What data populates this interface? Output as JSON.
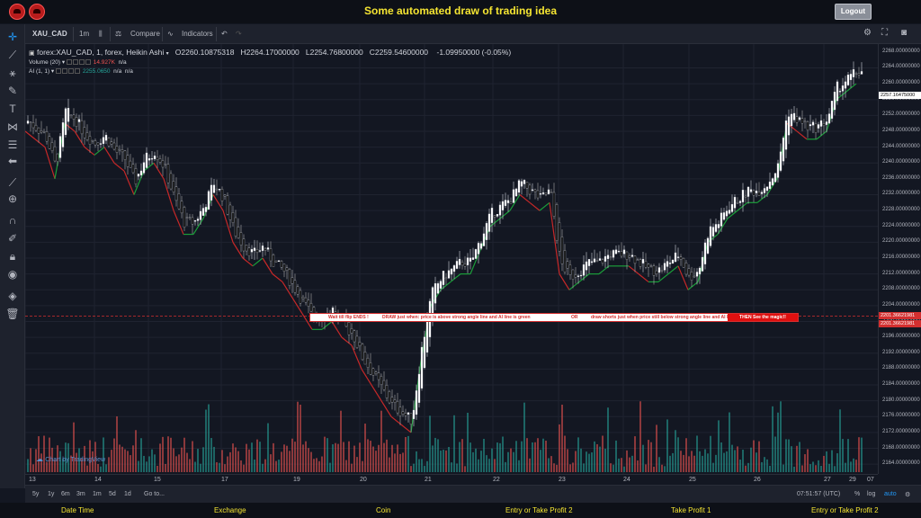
{
  "header": {
    "title": "Some automated draw of trading idea",
    "logout_label": "Logout"
  },
  "toolbar": {
    "symbol": "XAU_CAD",
    "interval": "1m",
    "compare_label": "Compare",
    "indicators_label": "Indicators"
  },
  "legend": {
    "title": "forex:XAU_CAD, 1, forex, Heikin Ashi",
    "open": "O2260.10875318",
    "high": "H2264.17000000",
    "low": "L2254.76800000",
    "close": "C2259.54600000",
    "change": "-1.09950000 (-0.05%)",
    "volume_label": "Volume (20)",
    "volume_value": "14.927K",
    "volume_na": "n/a",
    "ai_label": "AI (1, 1)",
    "ai_value": "2255.0650",
    "ai_na1": "n/a",
    "ai_na2": "n/a"
  },
  "banner": {
    "part1": "Wait till flip ENDS !",
    "part2": "DRAW just when:  price is above strong angle line and AI line is green",
    "part3": "OR",
    "part4": "draw shorts just when price still below strong angle line and AI line is red",
    "magic": "THEN See the magic!!"
  },
  "price_axis": {
    "ticks": [
      "2268.00000000",
      "2264.00000000",
      "2260.00000000",
      "2256.00000000",
      "2252.00000000",
      "2248.00000000",
      "2244.00000000",
      "2240.00000000",
      "2236.00000000",
      "2232.00000000",
      "2228.00000000",
      "2224.00000000",
      "2220.00000000",
      "2216.00000000",
      "2212.00000000",
      "2208.00000000",
      "2204.00000000",
      "2200.00000000",
      "2196.00000000",
      "2192.00000000",
      "2188.00000000",
      "2184.00000000",
      "2180.00000000",
      "2176.00000000",
      "2172.00000000",
      "2168.00000000",
      "2164.00000000"
    ],
    "current_price": "2257.16475000",
    "line_price_1": "2201.36621981",
    "line_price_2": "2201.36621981"
  },
  "time_axis": {
    "ticks": [
      "13",
      "14",
      "15",
      "16",
      "17",
      "18",
      "19",
      "20",
      "21",
      "22",
      "23",
      "24",
      "25",
      "26",
      "27",
      "28",
      "29",
      "29",
      "07"
    ]
  },
  "range_bar": {
    "ranges": [
      "5y",
      "1y",
      "6m",
      "3m",
      "1m",
      "5d",
      "1d"
    ],
    "goto": "Go to...",
    "clock": "07:51:57 (UTC)",
    "pct": "%",
    "log": "log",
    "auto": "auto"
  },
  "watermark": "Chart by TradingView",
  "bottom_nav": {
    "items": [
      "Date Time",
      "Exchange",
      "Coin",
      "Entry or Take Profit 2",
      "Take Profit 1",
      "Entry or Take Profit 2"
    ]
  },
  "colors": {
    "background": "#131722",
    "up": "#26a69a",
    "down": "#ef5350",
    "ai_line_green": "#1b9e3a",
    "ai_line_red": "#c62828",
    "title_yellow": "#f5e532"
  },
  "chart_data": {
    "type": "line",
    "ylim": [
      2162,
      2270
    ],
    "ai_line": [
      [
        0,
        2248
      ],
      [
        10,
        2246
      ],
      [
        20,
        2244
      ],
      [
        30,
        2236
      ],
      [
        40,
        2250
      ],
      [
        50,
        2248
      ],
      [
        60,
        2244
      ],
      [
        70,
        2242
      ],
      [
        80,
        2244
      ],
      [
        90,
        2240
      ],
      [
        100,
        2238
      ],
      [
        110,
        2232
      ],
      [
        120,
        2238
      ],
      [
        130,
        2240
      ],
      [
        140,
        2236
      ],
      [
        150,
        2228
      ],
      [
        160,
        2222
      ],
      [
        170,
        2222
      ],
      [
        180,
        2226
      ],
      [
        190,
        2232
      ],
      [
        200,
        2228
      ],
      [
        210,
        2220
      ],
      [
        220,
        2216
      ],
      [
        230,
        2214
      ],
      [
        240,
        2216
      ],
      [
        250,
        2212
      ],
      [
        260,
        2210
      ],
      [
        270,
        2206
      ],
      [
        280,
        2202
      ],
      [
        290,
        2198
      ],
      [
        300,
        2198
      ],
      [
        310,
        2200
      ],
      [
        320,
        2196
      ],
      [
        330,
        2194
      ],
      [
        340,
        2188
      ],
      [
        350,
        2184
      ],
      [
        360,
        2180
      ],
      [
        370,
        2176
      ],
      [
        380,
        2174
      ],
      [
        390,
        2172
      ],
      [
        400,
        2190
      ],
      [
        410,
        2204
      ],
      [
        420,
        2208
      ],
      [
        430,
        2210
      ],
      [
        440,
        2212
      ],
      [
        450,
        2212
      ],
      [
        460,
        2218
      ],
      [
        470,
        2224
      ],
      [
        480,
        2226
      ],
      [
        490,
        2228
      ],
      [
        500,
        2232
      ],
      [
        510,
        2230
      ],
      [
        520,
        2228
      ],
      [
        530,
        2230
      ],
      [
        540,
        2212
      ],
      [
        550,
        2208
      ],
      [
        560,
        2210
      ],
      [
        570,
        2212
      ],
      [
        580,
        2212
      ],
      [
        590,
        2214
      ],
      [
        600,
        2214
      ],
      [
        610,
        2214
      ],
      [
        620,
        2212
      ],
      [
        630,
        2210
      ],
      [
        640,
        2210
      ],
      [
        650,
        2212
      ],
      [
        660,
        2214
      ],
      [
        670,
        2208
      ],
      [
        680,
        2210
      ],
      [
        690,
        2220
      ],
      [
        700,
        2222
      ],
      [
        710,
        2226
      ],
      [
        720,
        2228
      ],
      [
        730,
        2230
      ],
      [
        740,
        2230
      ],
      [
        750,
        2232
      ],
      [
        760,
        2236
      ],
      [
        770,
        2250
      ],
      [
        780,
        2248
      ],
      [
        790,
        2246
      ],
      [
        800,
        2246
      ],
      [
        810,
        2248
      ],
      [
        820,
        2256
      ],
      [
        830,
        2258
      ],
      [
        840,
        2260
      ]
    ]
  }
}
